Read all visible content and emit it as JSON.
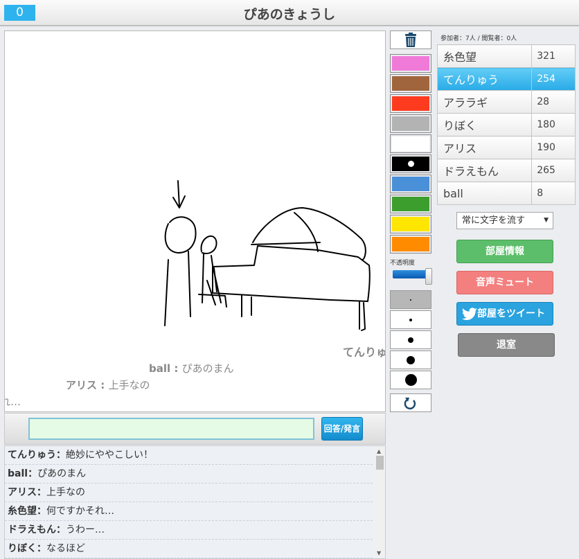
{
  "header": {
    "score_badge": "0",
    "title": "ぴあのきょうし"
  },
  "canvas": {
    "floating_messages": [
      {
        "name": "てんりゅ",
        "text": ""
      },
      {
        "name": "ball",
        "text": "ぴあのまん"
      },
      {
        "name": "アリス",
        "text": "上手なの"
      },
      {
        "name": "",
        "text": "れ…"
      }
    ]
  },
  "input": {
    "value": "",
    "answer_button": "回答/発言"
  },
  "chat_log": [
    {
      "name": "てんりゅう",
      "text": "絶妙にややこしい！"
    },
    {
      "name": "ball",
      "text": "ぴあのまん"
    },
    {
      "name": "アリス",
      "text": "上手なの"
    },
    {
      "name": "糸色望",
      "text": "何ですかそれ…"
    },
    {
      "name": "ドラえもん",
      "text": "うわー…"
    },
    {
      "name": "りぼく",
      "text": "なるほど"
    }
  ],
  "tools": {
    "trash_icon": "trash-icon",
    "colors": [
      "#f07ad8",
      "#a0653c",
      "#ff3b1f",
      "#b3b3b3",
      "#ffffff",
      "#000000",
      "#4a90d9",
      "#3c9e2c",
      "#ffe600",
      "#ff8c00"
    ],
    "selected_color": "#000000",
    "opacity_label": "不透明度",
    "opacity_value": 1.0,
    "brush_sizes": [
      1,
      2,
      3,
      4,
      5
    ],
    "selected_size": 1,
    "undo_icon": "undo-icon"
  },
  "participants": {
    "info": "参加者：7人 / 閲覧者：0人",
    "players": [
      {
        "name": "糸色望",
        "score": "321",
        "active": false
      },
      {
        "name": "てんりゅう",
        "score": "254",
        "active": true
      },
      {
        "name": "アララギ",
        "score": "28",
        "active": false
      },
      {
        "name": "りぼく",
        "score": "180",
        "active": false
      },
      {
        "name": "アリス",
        "score": "190",
        "active": false
      },
      {
        "name": "ドラえもん",
        "score": "265",
        "active": false
      },
      {
        "name": "ball",
        "score": "8",
        "active": false
      }
    ]
  },
  "controls": {
    "flow_select": "常に文字を流す",
    "room_info": "部屋情報",
    "mute": "音声ミュート",
    "tweet": "部屋をツイート",
    "leave": "退室"
  }
}
